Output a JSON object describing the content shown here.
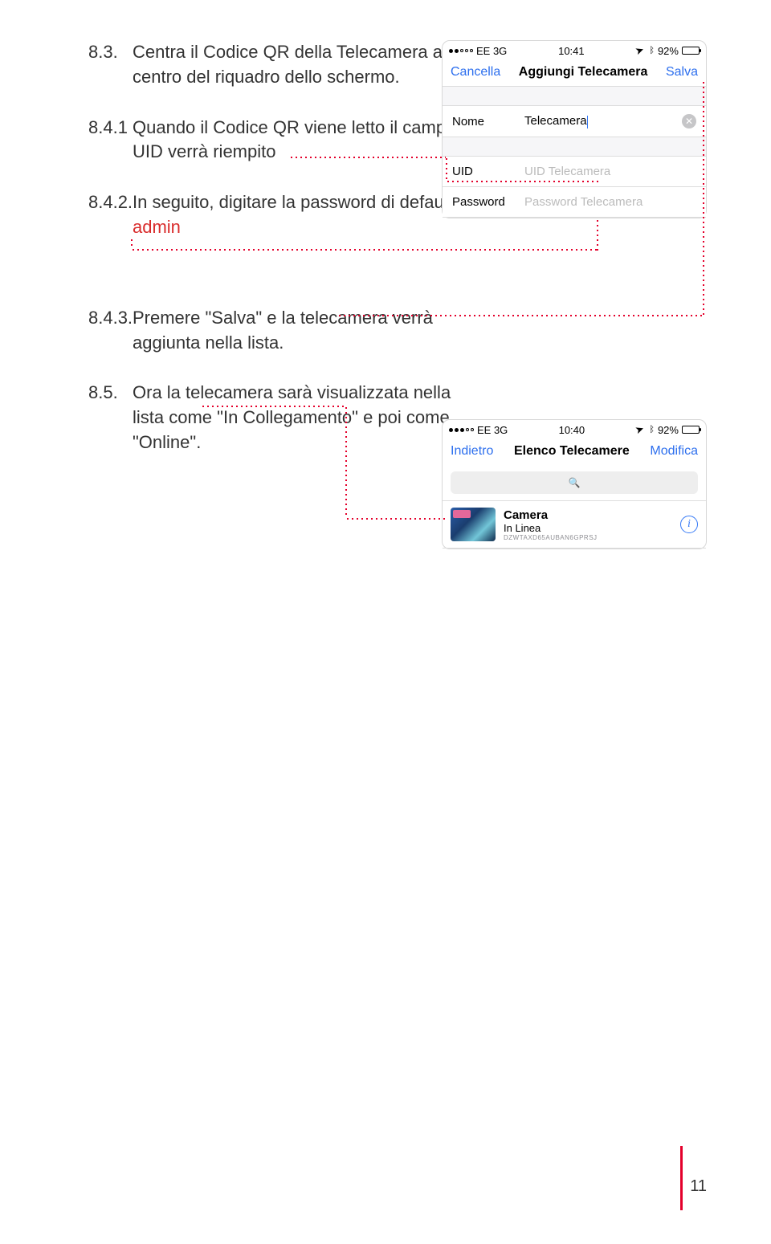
{
  "instructions": {
    "s83_num": "8.3.",
    "s83_txt": "Centra il Codice QR della Telecamera al centro del riquadro dello schermo.",
    "s841_num": "8.4.1",
    "s841_txt": "Quando il Codice QR viene letto il campo UID verrà riempito",
    "s842_num": "8.4.2.",
    "s842_txt_a": "In seguito, digitare la password di default:",
    "s842_admin": "admin",
    "s843_num": "8.4.3.",
    "s843_txt": "Premere \"Salva\" e la telecamera verrà aggiunta nella lista.",
    "s85_num": "8.5.",
    "s85_txt": "Ora la telecamera sarà visualizzata nella lista come \"In Collegamento\" e poi come \"Online\"."
  },
  "phone1": {
    "status": {
      "carrier": "EE  3G",
      "time": "10:41",
      "battery": "92%"
    },
    "nav": {
      "left": "Cancella",
      "center": "Aggiungi Telecamera",
      "right": "Salva"
    },
    "rows": {
      "nome_lbl": "Nome",
      "nome_val": "Telecamera",
      "uid_lbl": "UID",
      "uid_ph": "UID Telecamera",
      "pwd_lbl": "Password",
      "pwd_ph": "Password Telecamera"
    }
  },
  "phone2": {
    "status": {
      "carrier": "EE  3G",
      "time": "10:40",
      "battery": "92%"
    },
    "nav": {
      "left": "Indietro",
      "center": "Elenco Telecamere",
      "right": "Modifica"
    },
    "search_icon": "🔍",
    "camera": {
      "name": "Camera",
      "state": "In Linea",
      "uid": "DZWTAXD65AUBAN6GPRSJ"
    }
  },
  "page_number": "11"
}
